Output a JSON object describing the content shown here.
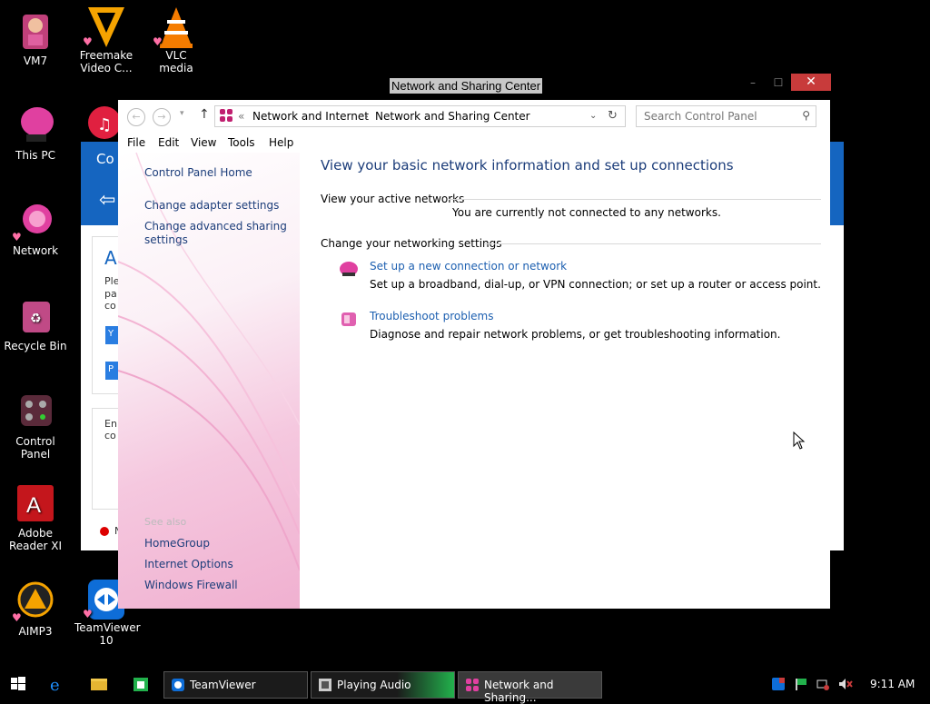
{
  "desktop": {
    "icons": [
      {
        "label": "VM7"
      },
      {
        "label": "Freemake Video C..."
      },
      {
        "label": "VLC media player"
      },
      {
        "label": "This PC"
      },
      {
        "label": "Network"
      },
      {
        "label": "Recycle Bin"
      },
      {
        "label": "Control Panel"
      },
      {
        "label": "Adobe Reader XI"
      },
      {
        "label": "AIMP3"
      },
      {
        "label": "TeamViewer 10"
      }
    ]
  },
  "background_window": {
    "title_fragment": "Co",
    "heading_fragment": "Al",
    "text_lines": [
      "Ple",
      "pa",
      "co"
    ],
    "btn1": "Y",
    "btn2": "P",
    "text2_lines": [
      "En",
      "co"
    ],
    "dot_label": "N"
  },
  "window": {
    "title": "Network and Sharing Center",
    "controls": {
      "minimize": "–",
      "maximize": "☐",
      "close": "✕"
    },
    "address": {
      "chevron": "«",
      "crumb1": "Network and Internet",
      "separator": "›",
      "crumb2": "Network and Sharing Center",
      "search_placeholder": "Search Control Panel"
    },
    "menu": [
      "File",
      "Edit",
      "View",
      "Tools",
      "Help"
    ],
    "sidebar": {
      "home": "Control Panel Home",
      "links": [
        "Change adapter settings",
        "Change advanced sharing settings"
      ],
      "see_also_label": "See also",
      "see_also": [
        "HomeGroup",
        "Internet Options",
        "Windows Firewall"
      ]
    },
    "main": {
      "heading": "View your basic network information and set up connections",
      "active_networks_label": "View your active networks",
      "not_connected": "You are currently not connected to any networks.",
      "change_settings_label": "Change your networking settings",
      "tasks": [
        {
          "title": "Set up a new connection or network",
          "desc": "Set up a broadband, dial-up, or VPN connection; or set up a router or access point."
        },
        {
          "title": "Troubleshoot problems",
          "desc": "Diagnose and repair network problems, or get troubleshooting information."
        }
      ]
    }
  },
  "taskbar": {
    "buttons": [
      "TeamViewer",
      "Playing Audio",
      "Network and Sharing..."
    ],
    "clock": "9:11 AM"
  },
  "colors": {
    "accent_pink": "#e040a0",
    "link_blue": "#1c5fb0",
    "close_red": "#c83b3b",
    "audio_green": "#22b14c"
  }
}
